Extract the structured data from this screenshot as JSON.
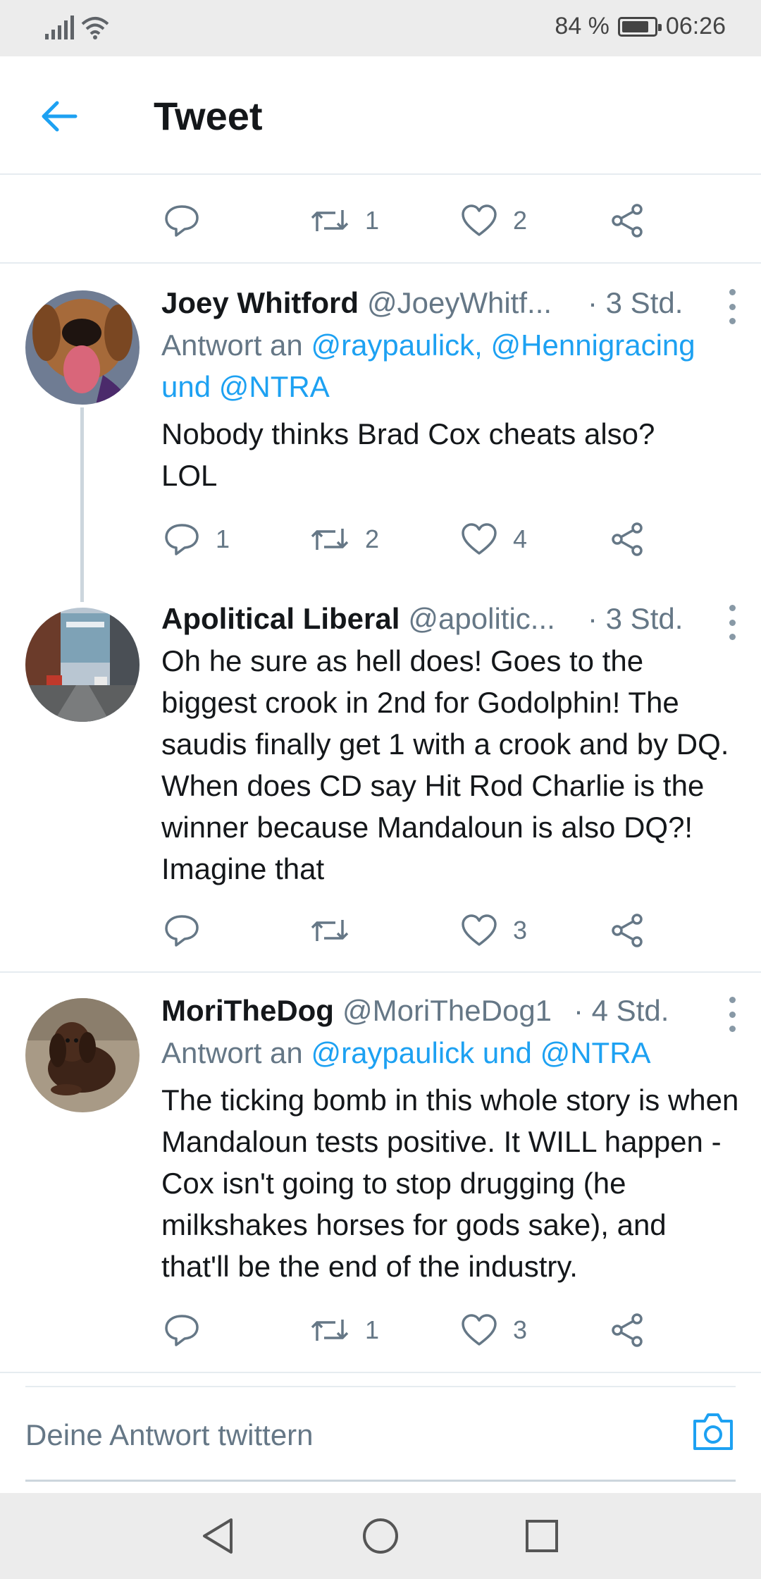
{
  "status_bar": {
    "battery": "84 %",
    "battery_level": 0.84,
    "time": "06:26"
  },
  "header": {
    "title": "Tweet"
  },
  "top_actions": {
    "retweets": "1",
    "likes": "2"
  },
  "tweets": [
    {
      "name": "Joey Whitford",
      "handle": "@JoeyWhitf...",
      "time": "· 3 Std.",
      "reply_prefix": "Antwort an",
      "reply_links": "@raypaulick, @Hennigracing und @NTRA",
      "body": "Nobody thinks Brad Cox cheats also? LOL",
      "replies": "1",
      "retweets": "2",
      "likes": "4"
    },
    {
      "name": "Apolitical Liberal",
      "handle": "@apolitic...",
      "time": "· 3 Std.",
      "body": "Oh he sure as hell does!  Goes to the biggest crook in 2nd for Godolphin!  The saudis finally get 1 with a crook and by DQ.   When does CD say Hit Rod Charlie is the winner because Mandaloun is also DQ?!  Imagine that",
      "replies": "",
      "retweets": "",
      "likes": "3"
    },
    {
      "name": "MoriTheDog",
      "handle": "@MoriTheDog1",
      "time": "· 4 Std.",
      "reply_prefix": "Antwort an",
      "reply_links": "@raypaulick und @NTRA",
      "body": "The ticking bomb in this whole story is when Mandaloun tests positive. It WILL happen - Cox isn't going to stop drugging (he milkshakes horses for gods sake), and that'll be the end of the industry.",
      "replies": "",
      "retweets": "1",
      "likes": "3"
    }
  ],
  "compose": {
    "placeholder": "Deine Antwort twittern"
  },
  "colors": {
    "accent": "#1da1f2",
    "secondary_text": "#657786",
    "divider": "#e6ecf0"
  },
  "icons": [
    "back-arrow-icon",
    "reply-icon",
    "retweet-icon",
    "like-icon",
    "share-icon",
    "camera-icon",
    "more-icon"
  ]
}
